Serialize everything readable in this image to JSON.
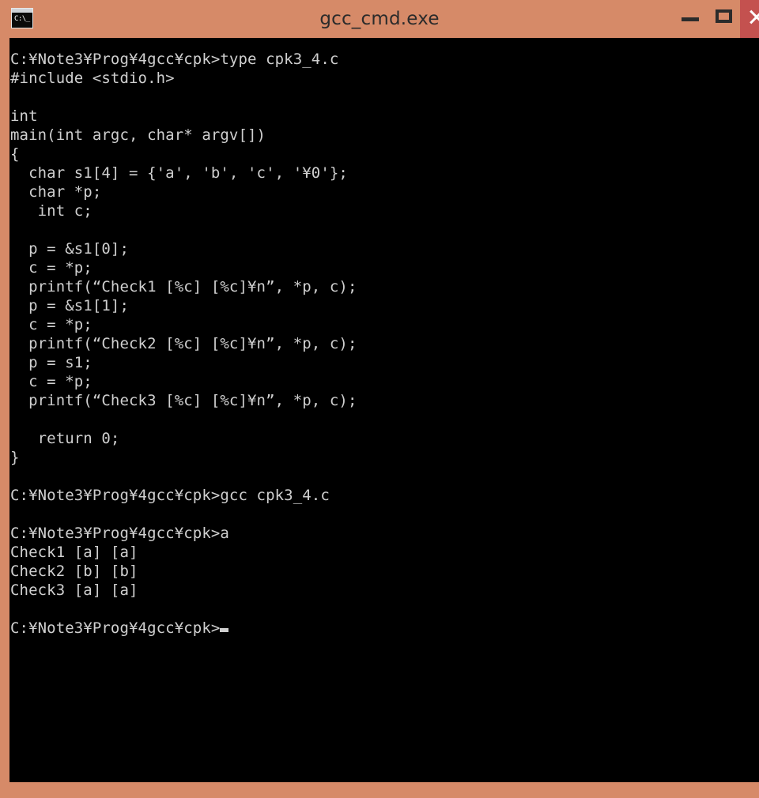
{
  "window": {
    "title": "gcc_cmd.exe",
    "icon_name": "console-window-icon",
    "icon_glyph": "C:\\_",
    "colors": {
      "titlebar": "#d68a68",
      "border": "#d68a68",
      "close_button": "#c4514f",
      "console_background": "#000000",
      "console_text": "#cfcfcf",
      "title_text": "#2b2b2b"
    },
    "controls": {
      "minimize_label": "–",
      "maximize_label": "□",
      "close_label": "×"
    }
  },
  "console": {
    "prompt": "C:¥Note3¥Prog¥4gcc¥cpk>",
    "lines": [
      "C:¥Note3¥Prog¥4gcc¥cpk>type cpk3_4.c",
      "#include <stdio.h>",
      "",
      "int",
      "main(int argc, char* argv[])",
      "{",
      "  char s1[4] = {'a', 'b', 'c', '¥0'};",
      "  char *p;",
      "   int c;",
      "",
      "  p = &s1[0];",
      "  c = *p;",
      "  printf(“Check1 [%c] [%c]¥n”, *p, c);",
      "  p = &s1[1];",
      "  c = *p;",
      "  printf(“Check2 [%c] [%c]¥n”, *p, c);",
      "  p = s1;",
      "  c = *p;",
      "  printf(“Check3 [%c] [%c]¥n”, *p, c);",
      "",
      "   return 0;",
      "}",
      "",
      "C:¥Note3¥Prog¥4gcc¥cpk>gcc cpk3_4.c",
      "",
      "C:¥Note3¥Prog¥4gcc¥cpk>a",
      "Check1 [a] [a]",
      "Check2 [b] [b]",
      "Check3 [a] [a]",
      "",
      "C:¥Note3¥Prog¥4gcc¥cpk>"
    ],
    "source_file": "cpk3_4.c",
    "commands": [
      "type cpk3_4.c",
      "gcc cpk3_4.c",
      "a"
    ],
    "program_output": [
      "Check1 [a] [a]",
      "Check2 [b] [b]",
      "Check3 [a] [a]"
    ],
    "cursor_visible": true
  }
}
